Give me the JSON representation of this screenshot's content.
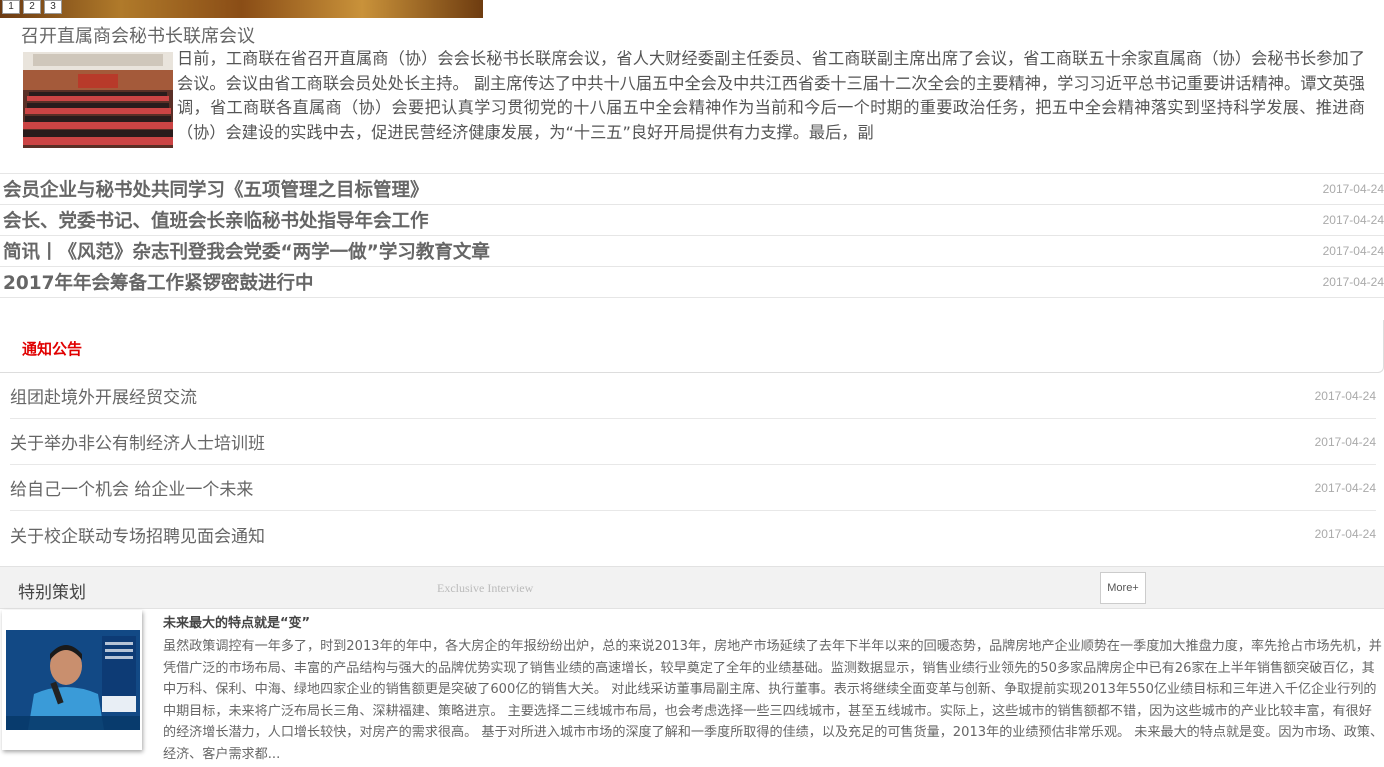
{
  "slider": {
    "pages": [
      "1",
      "2",
      "3"
    ]
  },
  "feature": {
    "title": "召开直属商会秘书长联席会议",
    "body": "日前，工商联在省召开直属商（协）会会长秘书长联席会议，省人大财经委副主任委员、省工商联副主席出席了会议，省工商联五十余家直属商（协）会秘书长参加了会议。会议由省工商联会员处处长主持。 副主席传达了中共十八届五中全会及中共江西省委十三届十二次全会的主要精神，学习习近平总书记重要讲话精神。谭文英强调，省工商联各直属商（协）会要把认真学习贯彻党的十八届五中全会精神作为当前和今后一个时期的重要政治任务，把五中全会精神落实到坚持科学发展、推进商（协）会建设的实践中去，促进民营经济健康发展，为“十三五”良好开局提供有力支撑。最后，副"
  },
  "headlines": [
    {
      "text": "会员企业与秘书处共同学习《五项管理之目标管理》",
      "date": "2017-04-24"
    },
    {
      "text": "会长、党委书记、值班会长亲临秘书处指导年会工作",
      "date": "2017-04-24"
    },
    {
      "text": "简讯丨《风范》杂志刊登我会党委“两学一做”学习教育文章",
      "date": "2017-04-24"
    },
    {
      "text": "2017年年会筹备工作紧锣密鼓进行中",
      "date": "2017-04-24"
    }
  ],
  "notice": {
    "title": "通知公告",
    "items": [
      {
        "text": "组团赴境外开展经贸交流",
        "date": "2017-04-24"
      },
      {
        "text": "关于举办非公有制经济人士培训班",
        "date": "2017-04-24"
      },
      {
        "text": "给自己一个机会 给企业一个未来",
        "date": "2017-04-24"
      },
      {
        "text": "关于校企联动专场招聘见面会通知",
        "date": "2017-04-24"
      }
    ]
  },
  "special": {
    "title": "特别策划",
    "subtitle": "Exclusive Interview",
    "more_label": "More+",
    "article_title": "未来最大的特点就是“变”",
    "article_body": "虽然政策调控有一年多了，时到2013年的年中，各大房企的年报纷纷出炉，总的来说2013年，房地产市场延续了去年下半年以来的回暖态势，品牌房地产企业顺势在一季度加大推盘力度，率先抢占市场先机，并凭借广泛的市场布局、丰富的产品结构与强大的品牌优势实现了销售业绩的高速增长，较早奠定了全年的业绩基础。监测数据显示，销售业绩行业领先的50多家品牌房企中已有26家在上半年销售额突破百亿，其中万科、保利、中海、绿地四家企业的销售额更是突破了600亿的销售大关。 对此线采访董事局副主席、执行董事。表示将继续全面变革与创新、争取提前实现2013年550亿业绩目标和三年进入千亿企业行列的中期目标，未来将广泛布局长三角、深耕福建、策略进京。 主要选择二三线城市布局，也会考虑选择一些三四线城市，甚至五线城市。实际上，这些城市的销售额都不错，因为这些城市的产业比较丰富，有很好的经济增长潜力，人口增长较快，对房产的需求很高。 基于对所进入城市市场的深度了解和一季度所取得的佳绩，以及充足的可售货量，2013年的业绩预估非常乐观。 未来最大的特点就是变。因为市场、政策、经济、客户需求都..."
  }
}
